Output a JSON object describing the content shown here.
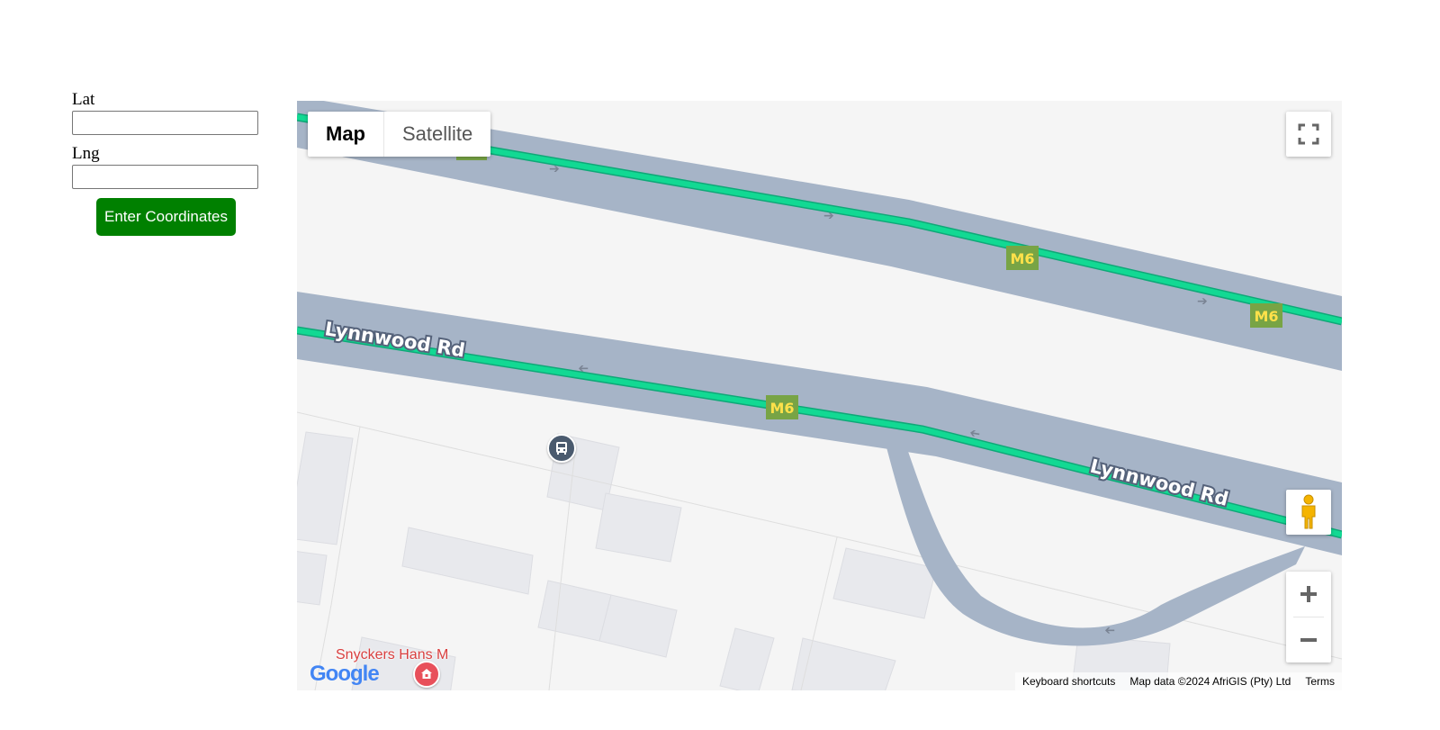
{
  "form": {
    "lat_label": "Lat",
    "lat_value": "",
    "lng_label": "Lng",
    "lng_value": "",
    "submit_label": "Enter Coordinates",
    "submit_color": "#008000"
  },
  "map": {
    "type_tabs": {
      "map": "Map",
      "satellite": "Satellite",
      "selected": "Map"
    },
    "road_labels": {
      "upper_road": "Lynnwood Rd",
      "lower_road": "Lynnwood Rd"
    },
    "route_shields": [
      "M6",
      "M6",
      "M6",
      "M6"
    ],
    "poi_label": "Snyckers Hans M",
    "google_logo": "Google",
    "footer": {
      "keyboard_shortcuts": "Keyboard shortcuts",
      "map_data": "Map data ©2024 AfriGIS (Pty) Ltd",
      "terms": "Terms"
    },
    "icons": {
      "fullscreen": "fullscreen-icon",
      "pegman": "pegman-icon",
      "zoom_in": "plus-icon",
      "zoom_out": "minus-icon",
      "bus_stop": "bus-icon",
      "poi": "home-pin-icon"
    },
    "colors": {
      "road": "#a6b4c7",
      "route_line": "#12d993",
      "shield_bg": "#78a445",
      "shield_text": "#ffe14a",
      "background": "#f5f5f5",
      "building": "#e8e9ed"
    }
  }
}
